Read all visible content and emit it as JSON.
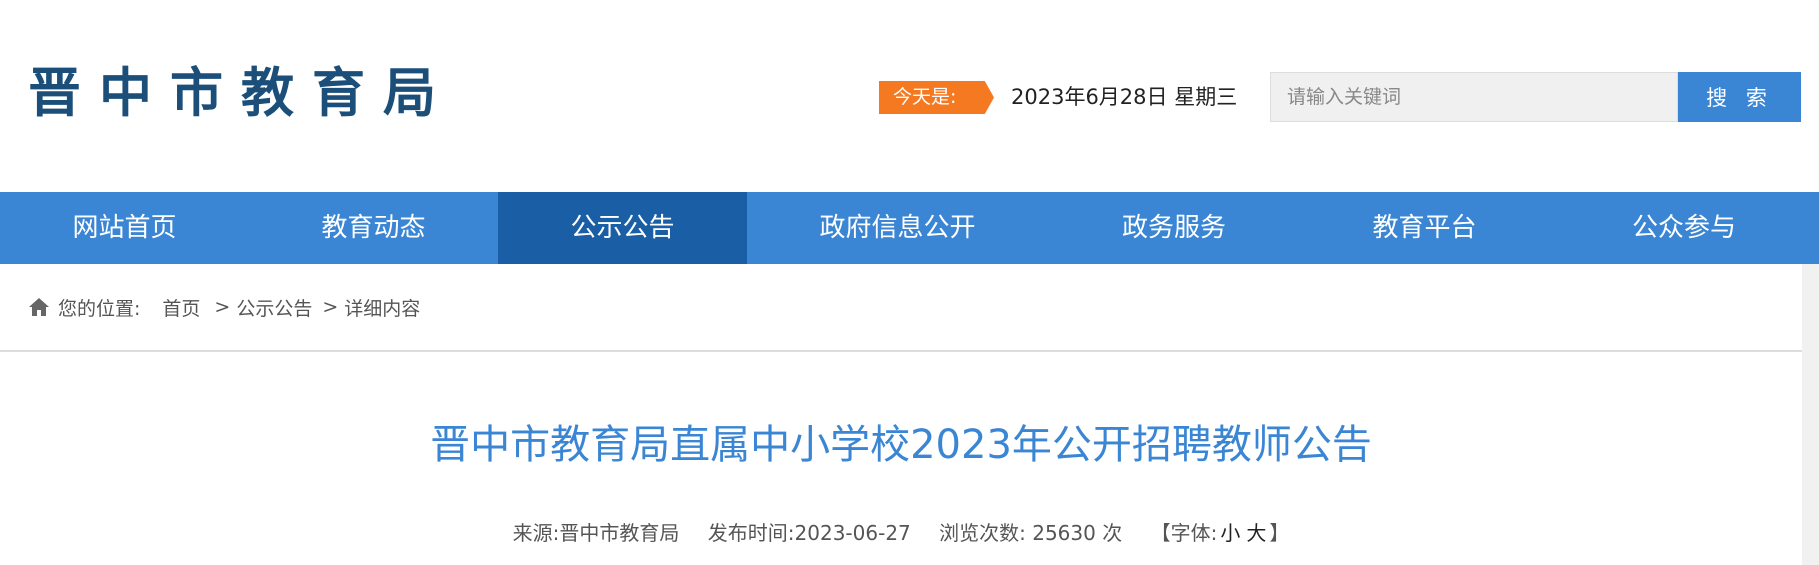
{
  "header": {
    "logo_text": "晋中市教育局",
    "today_label": "今天是:",
    "date_text": "2023年6月28日 星期三",
    "search": {
      "placeholder": "请输入关键词",
      "button_label": "搜 索"
    }
  },
  "nav": {
    "items": [
      {
        "label": "网站首页"
      },
      {
        "label": "教育动态"
      },
      {
        "label": "公示公告"
      },
      {
        "label": "政府信息公开"
      },
      {
        "label": "政务服务"
      },
      {
        "label": "教育平台"
      },
      {
        "label": "公众参与"
      }
    ],
    "active_index": 2
  },
  "breadcrumb": {
    "label": "您的位置:",
    "items": [
      "首页",
      "公示公告",
      "详细内容"
    ],
    "separator": ">"
  },
  "article": {
    "title": "晋中市教育局直属中小学校2023年公开招聘教师公告",
    "meta": {
      "source_label": "来源:",
      "source_value": "晋中市教育局",
      "publish_label": "发布时间:",
      "publish_value": "2023-06-27",
      "views_label": "浏览次数:",
      "views_value": "25630",
      "views_unit": "次",
      "font_open": "【字体:",
      "font_small": "小",
      "font_large": "大",
      "font_close": "】"
    }
  },
  "colors": {
    "brand_blue": "#3a86d4",
    "nav_active": "#1a5ea6",
    "logo_blue": "#1b4f7a",
    "accent_orange": "#f47920"
  }
}
